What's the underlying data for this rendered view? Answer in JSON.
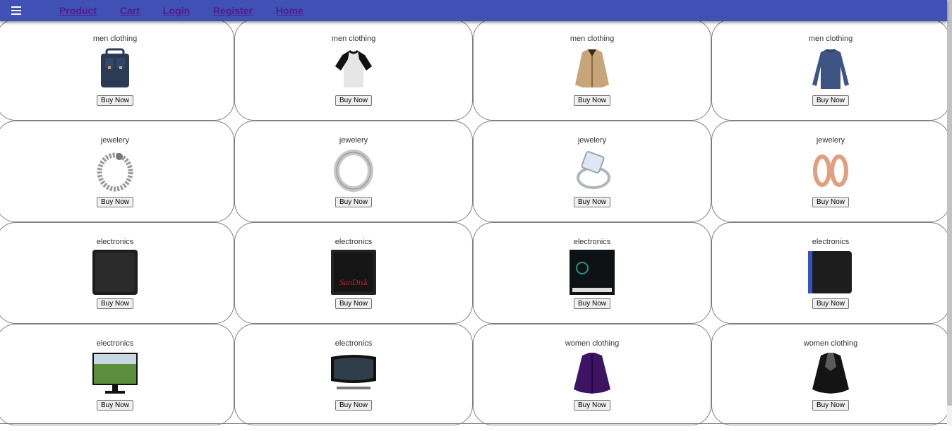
{
  "nav": {
    "menu_icon": "hamburger-menu-icon",
    "links": [
      "Product",
      "Cart",
      "Login",
      "Register",
      "Home"
    ]
  },
  "colors": {
    "topbar": "#3f51b5",
    "link": "#551a8b"
  },
  "products": [
    {
      "category": "men clothing",
      "image": "backpack",
      "button": "Buy Now"
    },
    {
      "category": "men clothing",
      "image": "raglan-tshirt",
      "button": "Buy Now"
    },
    {
      "category": "men clothing",
      "image": "cotton-jacket",
      "button": "Buy Now"
    },
    {
      "category": "men clothing",
      "image": "slim-fit-shirt",
      "button": "Buy Now"
    },
    {
      "category": "jewelery",
      "image": "chain-bracelet",
      "button": "Buy Now"
    },
    {
      "category": "jewelery",
      "image": "silver-ring",
      "button": "Buy Now"
    },
    {
      "category": "jewelery",
      "image": "diamond-ring",
      "button": "Buy Now"
    },
    {
      "category": "jewelery",
      "image": "rose-gold-earrings",
      "button": "Buy Now"
    },
    {
      "category": "electronics",
      "image": "external-hard-drive",
      "button": "Buy Now"
    },
    {
      "category": "electronics",
      "image": "sandisk-ssd",
      "button": "Buy Now"
    },
    {
      "category": "electronics",
      "image": "silicon-power-ssd",
      "button": "Buy Now"
    },
    {
      "category": "electronics",
      "image": "wd-portable-drive",
      "button": "Buy Now"
    },
    {
      "category": "electronics",
      "image": "acer-monitor",
      "button": "Buy Now"
    },
    {
      "category": "electronics",
      "image": "curved-monitor",
      "button": "Buy Now"
    },
    {
      "category": "women clothing",
      "image": "purple-snow-jacket",
      "button": "Buy Now"
    },
    {
      "category": "women clothing",
      "image": "leather-moto-jacket",
      "button": "Buy Now"
    }
  ]
}
